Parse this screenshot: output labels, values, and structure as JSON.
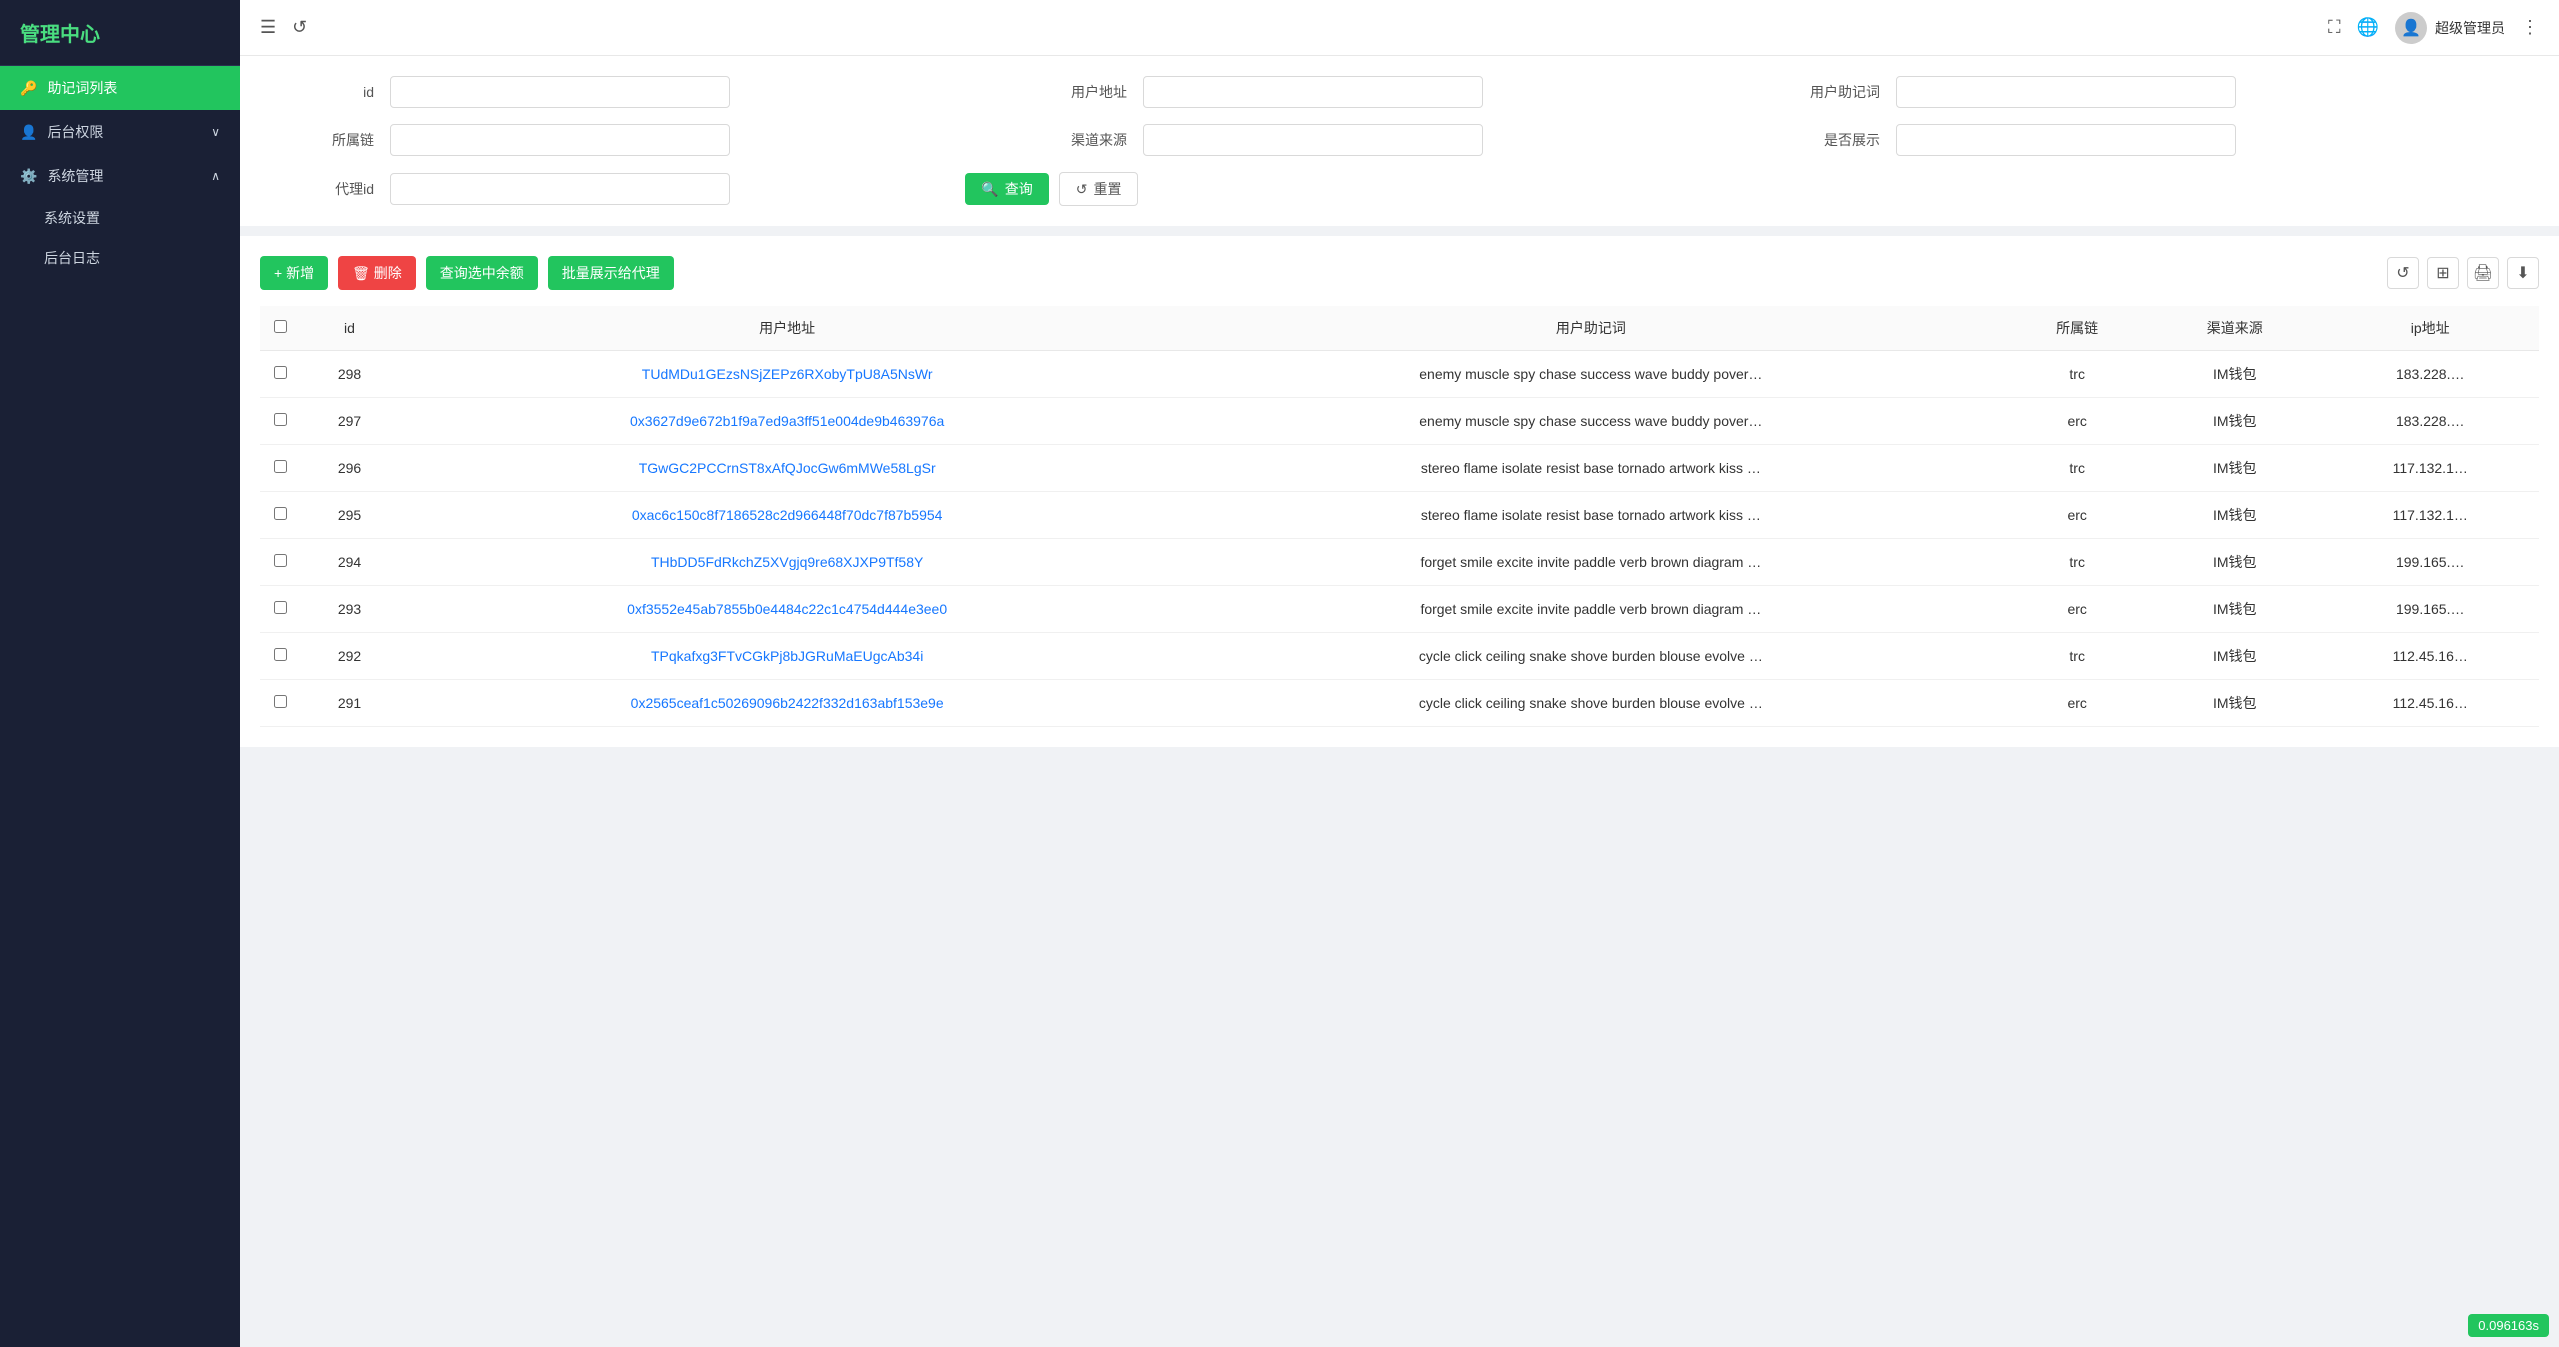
{
  "sidebar": {
    "logo": "管理中心",
    "items": [
      {
        "id": "mnemonic-list",
        "icon": "🔑",
        "label": "助记词列表",
        "active": true,
        "submenu": []
      },
      {
        "id": "backend-permission",
        "icon": "👤",
        "label": "后台权限",
        "active": false,
        "hasArrow": true,
        "submenu": []
      },
      {
        "id": "system-management",
        "icon": "⚙️",
        "label": "系统管理",
        "active": false,
        "hasArrow": true,
        "expanded": true,
        "submenu": [
          {
            "id": "system-settings",
            "label": "系统设置"
          },
          {
            "id": "backend-log",
            "label": "后台日志"
          }
        ]
      }
    ]
  },
  "topbar": {
    "menu_icon": "☰",
    "refresh_icon": "↺",
    "fullscreen_icon": "⛶",
    "lang_icon": "🌐",
    "more_icon": "⋮",
    "user_name": "超级管理员"
  },
  "filter": {
    "rows": [
      {
        "fields": [
          {
            "label": "id",
            "placeholder": ""
          },
          {
            "label": "用户地址",
            "placeholder": ""
          },
          {
            "label": "用户助记词",
            "placeholder": ""
          }
        ]
      },
      {
        "fields": [
          {
            "label": "所属链",
            "placeholder": ""
          },
          {
            "label": "渠道来源",
            "placeholder": ""
          },
          {
            "label": "是否展示",
            "placeholder": ""
          }
        ]
      },
      {
        "fields": [
          {
            "label": "代理id",
            "placeholder": ""
          }
        ],
        "hasButtons": true
      }
    ],
    "query_btn": "查询",
    "reset_btn": "重置"
  },
  "toolbar": {
    "add_label": "+ 新增",
    "delete_label": "🗑 删除",
    "query_balance_label": "查询选中余额",
    "batch_show_label": "批量展示给代理"
  },
  "table": {
    "columns": [
      "id",
      "用户地址",
      "用户助记词",
      "所属链",
      "渠道来源",
      "ip地址"
    ],
    "rows": [
      {
        "id": "298",
        "address": "TUdMDu1GEzsNSjZEPz6RXobyTpU8A5NsWr",
        "address_type": "trc_link",
        "mnemonic": "enemy muscle spy chase success wave buddy pover…",
        "chain": "trc",
        "channel": "IM钱包",
        "ip": "183.228.…"
      },
      {
        "id": "297",
        "address": "0x3627d9e672b1f9a7ed9a3ff51e004de9b463976a",
        "address_type": "erc_link",
        "mnemonic": "enemy muscle spy chase success wave buddy pover…",
        "chain": "erc",
        "channel": "IM钱包",
        "ip": "183.228.…"
      },
      {
        "id": "296",
        "address": "TGwGC2PCCrnST8xAfQJocGw6mMWe58LgSr",
        "address_type": "trc_link",
        "mnemonic": "stereo flame isolate resist base tornado artwork kiss …",
        "chain": "trc",
        "channel": "IM钱包",
        "ip": "117.132.1…"
      },
      {
        "id": "295",
        "address": "0xac6c150c8f7186528c2d966448f70dc7f87b5954",
        "address_type": "erc_link",
        "mnemonic": "stereo flame isolate resist base tornado artwork kiss …",
        "chain": "erc",
        "channel": "IM钱包",
        "ip": "117.132.1…"
      },
      {
        "id": "294",
        "address": "THbDD5FdRkchZ5XVgjq9re68XJXP9Tf58Y",
        "address_type": "trc_link",
        "mnemonic": "forget smile excite invite paddle verb brown diagram …",
        "chain": "trc",
        "channel": "IM钱包",
        "ip": "199.165.…"
      },
      {
        "id": "293",
        "address": "0xf3552e45ab7855b0e4484c22c1c4754d444e3ee0",
        "address_type": "erc_link",
        "mnemonic": "forget smile excite invite paddle verb brown diagram …",
        "chain": "erc",
        "channel": "IM钱包",
        "ip": "199.165.…"
      },
      {
        "id": "292",
        "address": "TPqkafxg3FTvCGkPj8bJGRuMaEUgcAb34i",
        "address_type": "trc_link",
        "mnemonic": "cycle click ceiling snake shove burden blouse evolve …",
        "chain": "trc",
        "channel": "IM钱包",
        "ip": "112.45.16…"
      },
      {
        "id": "291",
        "address": "0x2565ceaf1c50269096b2422f332d163abf153e9e",
        "address_type": "erc_link",
        "mnemonic": "cycle click ceiling snake shove burden blouse evolve …",
        "chain": "erc",
        "channel": "IM钱包",
        "ip": "112.45.16…"
      }
    ]
  },
  "bottom_badge": "0.096163s",
  "icons": {
    "search": "🔍",
    "refresh": "↺",
    "grid": "⊞",
    "print": "🖨",
    "download": "⬇"
  }
}
